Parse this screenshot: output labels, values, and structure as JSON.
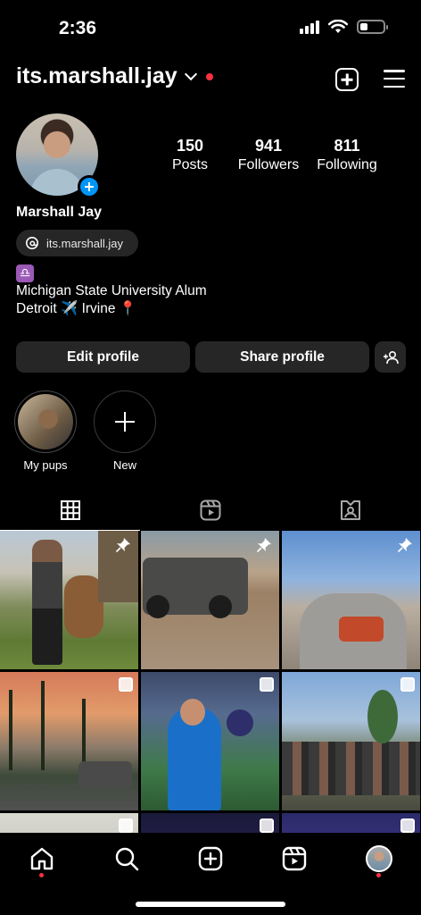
{
  "status_bar": {
    "time": "2:36"
  },
  "header": {
    "username": "its.marshall.jay"
  },
  "profile": {
    "stats": [
      {
        "num": "150",
        "label": "Posts"
      },
      {
        "num": "941",
        "label": "Followers"
      },
      {
        "num": "811",
        "label": "Following"
      }
    ],
    "full_name": "Marshall Jay",
    "threads_handle": "its.marshall.jay",
    "zodiac": "♎",
    "bio": [
      "Michigan State University Alum",
      "Detroit ✈️ Irvine 📍"
    ]
  },
  "actions": {
    "edit": "Edit profile",
    "share": "Share profile"
  },
  "highlights": [
    {
      "label": "My pups"
    },
    {
      "label": "New"
    }
  ],
  "colors": {
    "accent": "#0095f6",
    "badge": "#ff3040",
    "button_bg": "#262626"
  }
}
